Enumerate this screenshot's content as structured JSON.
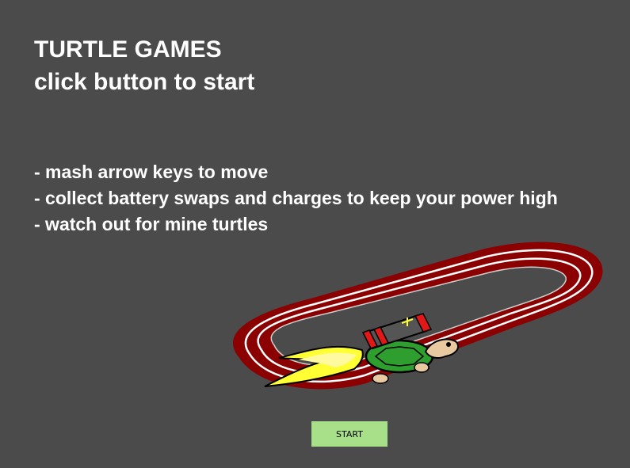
{
  "title": {
    "line1": "TURTLE GAMES",
    "line2": "click button to start"
  },
  "instructions": [
    "- mash arrow keys to move",
    "- collect battery swaps and charges to keep your power high",
    "- watch out for mine turtles"
  ],
  "start_button": {
    "label": "START"
  },
  "colors": {
    "background": "#4b4b4b",
    "text": "#ffffff",
    "track": "#8b0000",
    "track_lines": "#ffffff",
    "button": "#a8e08a",
    "turtle_shell": "#2e9e2e",
    "flame": "#ffff33",
    "battery_cap": "#e01818"
  },
  "icons": {
    "illustration": "turtle-racing-track-illustration"
  }
}
